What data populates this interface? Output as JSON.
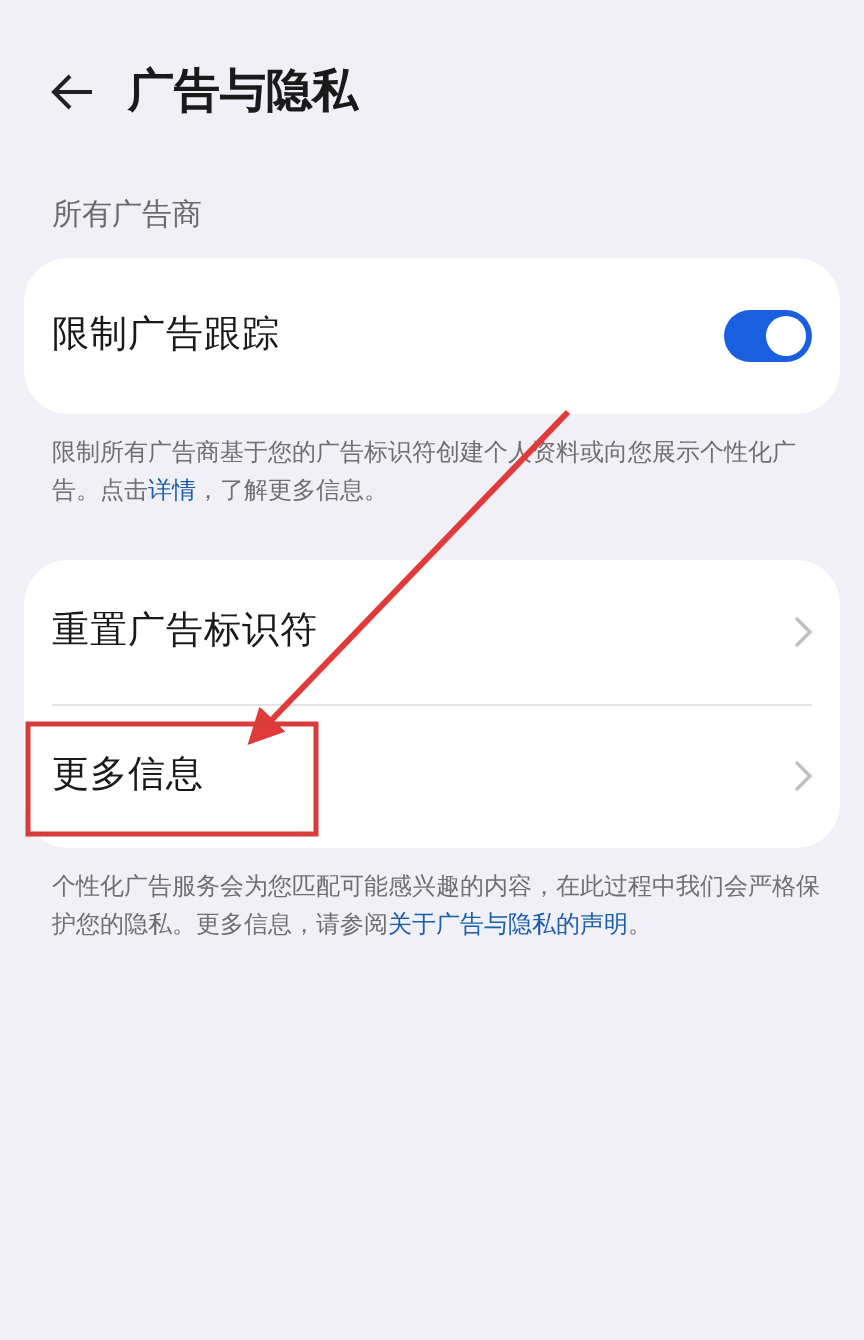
{
  "header": {
    "title": "广告与隐私"
  },
  "section_label": "所有广告商",
  "groups": [
    {
      "rows": [
        {
          "kind": "toggle",
          "label": "限制广告跟踪",
          "on": true
        }
      ],
      "note": {
        "before": "限制所有广告商基于您的广告标识符创建个人资料或向您展示个性化广告。点击",
        "link": "详情",
        "after": "，了解更多信息。"
      }
    },
    {
      "rows": [
        {
          "kind": "link",
          "label": "重置广告标识符"
        },
        {
          "kind": "link",
          "label": "更多信息"
        }
      ],
      "note": {
        "before": "个性化广告服务会为您匹配可能感兴趣的内容，在此过程中我们会严格保护您的隐私。更多信息，请参阅",
        "link": "关于广告与隐私的声明",
        "after": "。"
      }
    }
  ]
}
